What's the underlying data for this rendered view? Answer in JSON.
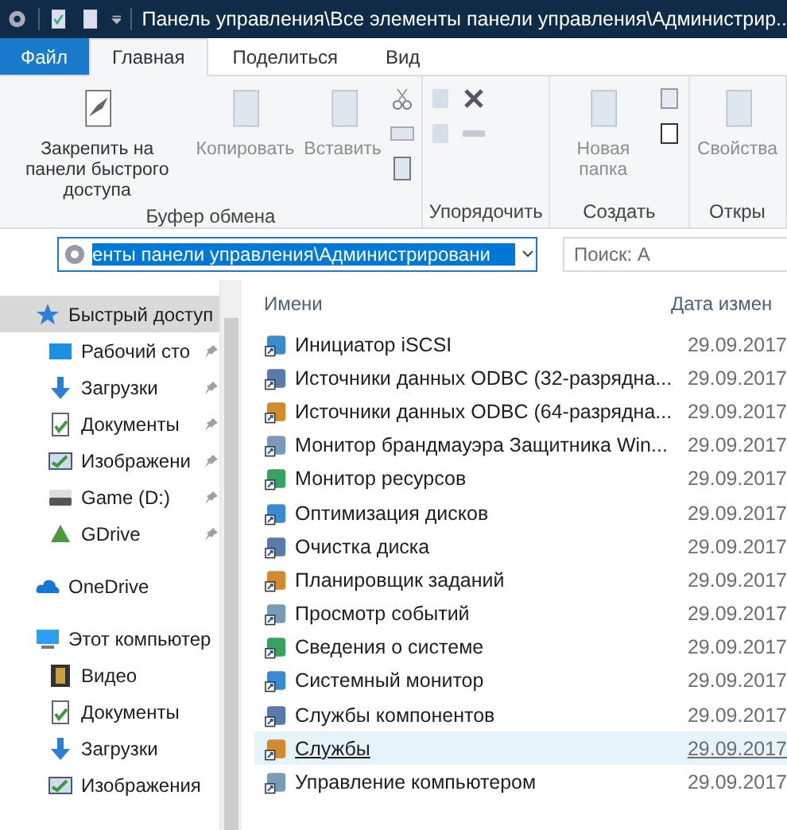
{
  "window": {
    "title": "Панель управления\\Все элементы панели управления\\Администрир.."
  },
  "tabs": [
    {
      "label": "Файл",
      "kind": "file",
      "selected": false
    },
    {
      "label": "Главная",
      "kind": "tab",
      "selected": true
    },
    {
      "label": "Поделиться",
      "kind": "tab",
      "selected": false
    },
    {
      "label": "Вид",
      "kind": "tab",
      "selected": false
    }
  ],
  "ribbon": {
    "groups": [
      {
        "label": "Буфер обмена",
        "buttons": [
          {
            "label": "Закрепить на панели быстрого доступа",
            "disabled": false
          },
          {
            "label": "Копировать",
            "disabled": true
          },
          {
            "label": "Вставить",
            "disabled": true
          }
        ]
      },
      {
        "label": "Упорядочить"
      },
      {
        "label": "Создать",
        "buttons": [
          {
            "label": "Новая папка",
            "disabled": true
          }
        ]
      },
      {
        "label": "Откры",
        "buttons": [
          {
            "label": "Свойства",
            "disabled": true
          }
        ]
      }
    ]
  },
  "address": {
    "value": "енты панели управления\\Администрировани",
    "selected": true
  },
  "search": {
    "placeholder": "Поиск: А"
  },
  "sidebar": {
    "items": [
      {
        "label": "Быстрый доступ",
        "selected": true,
        "children": [
          {
            "label": "Рабочий сто",
            "pinned": true
          },
          {
            "label": "Загрузки",
            "pinned": true
          },
          {
            "label": "Документы",
            "pinned": true
          },
          {
            "label": "Изображени",
            "pinned": true
          },
          {
            "label": "Game (D:)",
            "pinned": true
          },
          {
            "label": "GDrive",
            "pinned": true
          }
        ]
      },
      {
        "label": "OneDrive",
        "selected": false
      },
      {
        "label": "Этот компьютер",
        "selected": false,
        "children": [
          {
            "label": "Видео",
            "pinned": false
          },
          {
            "label": "Документы",
            "pinned": false
          },
          {
            "label": "Загрузки",
            "pinned": false
          },
          {
            "label": "Изображения",
            "pinned": false
          }
        ]
      }
    ]
  },
  "table": {
    "columns": [
      "Имени",
      "Дата измен"
    ],
    "rows": [
      {
        "name": "Инициатор iSCSI",
        "date": "29.09.2017",
        "hovered": false
      },
      {
        "name": "Источники данных ODBC (32-разрядна...",
        "date": "29.09.2017",
        "hovered": false
      },
      {
        "name": "Источники данных ODBC (64-разрядна...",
        "date": "29.09.2017",
        "hovered": false
      },
      {
        "name": "Монитор брандмауэра Защитника Win...",
        "date": "29.09.2017",
        "hovered": false
      },
      {
        "name": "Монитор ресурсов",
        "date": "29.09.2017",
        "hovered": false
      },
      {
        "name": "Оптимизация дисков",
        "date": "29.09.2017",
        "hovered": false
      },
      {
        "name": "Очистка диска",
        "date": "29.09.2017",
        "hovered": false
      },
      {
        "name": "Планировщик заданий",
        "date": "29.09.2017",
        "hovered": false
      },
      {
        "name": "Просмотр событий",
        "date": "29.09.2017",
        "hovered": false
      },
      {
        "name": "Сведения о системе",
        "date": "29.09.2017",
        "hovered": false
      },
      {
        "name": "Системный монитор",
        "date": "29.09.2017",
        "hovered": false
      },
      {
        "name": "Службы компонентов",
        "date": "29.09.2017",
        "hovered": false
      },
      {
        "name": "Службы",
        "date": "29.09.2017",
        "hovered": true
      },
      {
        "name": "Управление компьютером",
        "date": "29.09.2017",
        "hovered": false
      }
    ]
  }
}
